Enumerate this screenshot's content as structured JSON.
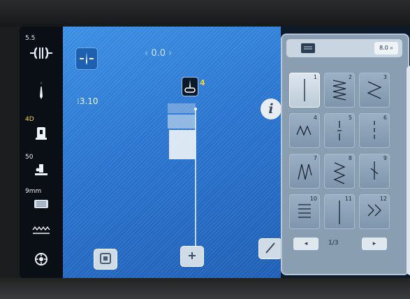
{
  "left_toolbar": {
    "stitch_width_value": "5.5",
    "needle_stop_value": "4D",
    "tension_value": "50",
    "foot_height_value": "9mm"
  },
  "canvas": {
    "needle_position_value": "0.0",
    "stitch_length_value": "3.10",
    "needle_number": "4",
    "info_label": "i"
  },
  "pattern_panel": {
    "search_label": "8.0",
    "selected": 1,
    "stitches": [
      "1",
      "2",
      "3",
      "4",
      "5",
      "6",
      "7",
      "8",
      "9",
      "10",
      "11",
      "12"
    ],
    "page_indicator": "1/3"
  }
}
